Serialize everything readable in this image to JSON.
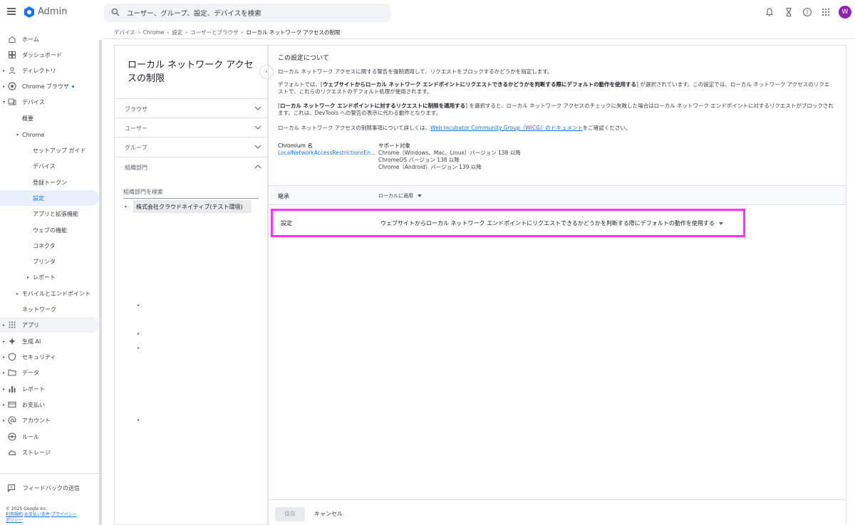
{
  "app": {
    "brand": "Admin"
  },
  "search": {
    "placeholder": "ユーザー、グループ、設定、デバイスを検索"
  },
  "user": {
    "avatar_initial": "W"
  },
  "sidebar": {
    "items": [
      {
        "label": "ホーム"
      },
      {
        "label": "ダッシュボード"
      },
      {
        "label": "ディレクトリ"
      },
      {
        "label": "Chrome ブラウザ"
      },
      {
        "label": "デバイス"
      },
      {
        "label": "概要"
      },
      {
        "label": "Chrome"
      },
      {
        "label": "セットアップ ガイド"
      },
      {
        "label": "デバイス"
      },
      {
        "label": "登録トークン"
      },
      {
        "label": "設定"
      },
      {
        "label": "アプリと拡張機能"
      },
      {
        "label": "ウェブの機能"
      },
      {
        "label": "コネクタ"
      },
      {
        "label": "プリンタ"
      },
      {
        "label": "レポート"
      },
      {
        "label": "モバイルとエンドポイント"
      },
      {
        "label": "ネットワーク"
      },
      {
        "label": "アプリ"
      },
      {
        "label": "生成 AI"
      },
      {
        "label": "セキュリティ"
      },
      {
        "label": "データ"
      },
      {
        "label": "レポート"
      },
      {
        "label": "お支払い"
      },
      {
        "label": "アカウント"
      },
      {
        "label": "ルール"
      },
      {
        "label": "ストレージ"
      }
    ],
    "feedback": "フィードバックの送信",
    "copyright": "© 2025 Google Inc.",
    "links": [
      "利用規約",
      "お支払い条件",
      "プライバシー",
      "ポリシー"
    ]
  },
  "breadcrumb": [
    "デバイス",
    "Chrome",
    "設定",
    "ユーザーとブラウザ",
    "ローカル ネットワーク アクセスの制限"
  ],
  "left_panel": {
    "title": "ローカル ネットワーク アクセスの制限",
    "filters": [
      "ブラウザ",
      "ユーザー",
      "グループ",
      "組織部門"
    ],
    "org_search_placeholder": "組織部門を検索",
    "org_unit": "株式会社クラウドネイティブ(テスト環境)"
  },
  "about": {
    "title": "この設定について",
    "p1": "ローカル ネットワーク アクセスに関する警告を強制適用して、リクエストをブロックするかどうかを指定します。",
    "p2_pre": "デフォルトでは、[",
    "p2_bold": "ウェブサイトからローカル ネットワーク エンドポイントにリクエストできるかどうかを判断する際にデフォルトの動作を使用する",
    "p2_post": "] が選択されています。この設定では、ローカル ネットワーク アクセスのリクエストで、これらのリクエストのデフォルト処理が使用されます。",
    "p3_pre": "[",
    "p3_bold": "ローカル ネットワーク エンドポイントに対するリクエストに制限を適用する",
    "p3_post": "] を選択すると、ローカル ネットワーク アクセスのチェックに失敗した場合はローカル ネットワーク エンドポイントに対するリクエストがブロックされます。これは、DevTools への警告の表示に代わる動作となります。",
    "p4_pre": "ローカル ネットワーク アクセスの制限事項について詳しくは、",
    "p4_link": "Web Incubator Community Group（WICG）のドキュメント",
    "p4_post": "をご確認ください。",
    "chromium_label": "Chromium 名",
    "chromium_value": "LocalNetworkAccessRestrictionsEn...",
    "support_label": "サポート対象",
    "support_lines": [
      "Chrome（Windows、Mac、Linux）バージョン 138 以降",
      "ChromeOS バージョン 138 以降",
      "Chrome（Android）バージョン 139 以降"
    ]
  },
  "inherit": {
    "label": "継承",
    "value": "ローカルに適用"
  },
  "setting": {
    "label": "設定",
    "value": "ウェブサイトからローカル ネットワーク エンドポイントにリクエストできるかどうかを判断する際にデフォルトの動作を使用する"
  },
  "footer": {
    "save": "保存",
    "cancel": "キャンセル"
  },
  "colors": {
    "accent": "#1a73e8",
    "highlight": "#ff33ff",
    "avatar": "#8e24aa"
  }
}
